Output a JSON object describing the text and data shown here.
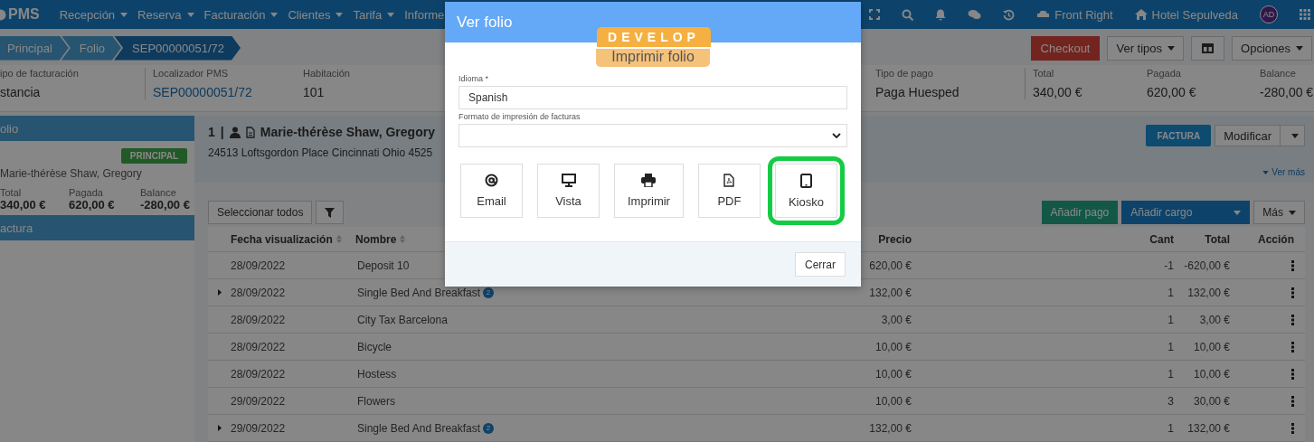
{
  "nav": {
    "logo": "PMS",
    "menu": [
      {
        "label": "Recepción"
      },
      {
        "label": "Reserva"
      },
      {
        "label": "Facturación"
      },
      {
        "label": "Clientes"
      },
      {
        "label": "Tarifa"
      },
      {
        "label": "Informe"
      }
    ],
    "location": "Front Right",
    "hotel": "Hotel Sepulveda",
    "avatar": "AD"
  },
  "breadcrumb": [
    {
      "label": "Principal",
      "selected": false
    },
    {
      "label": "Folio",
      "selected": false
    },
    {
      "label": "SEP00000051/72",
      "selected": true
    }
  ],
  "actions": [
    {
      "kind": "danger",
      "label": "Checkout"
    },
    {
      "kind": "dropdown",
      "label": "Ver tipos"
    },
    {
      "kind": "columns"
    },
    {
      "kind": "dropdown",
      "label": "Opciones"
    }
  ],
  "summary": [
    {
      "label": "ipo de facturación",
      "value": "stancia"
    },
    {
      "label": "Localizador PMS",
      "value": "SEP00000051/72",
      "kind": "link"
    },
    {
      "label": "Habitación",
      "value": "101"
    },
    {
      "label": "Tipo de pago",
      "value": "Paga Huesped"
    },
    {
      "label": "Total",
      "value": "340,00 €"
    },
    {
      "label": "Pagada",
      "value": "620,00 €"
    },
    {
      "label": "Balance",
      "value": "-280,00 €"
    }
  ],
  "left_panel": {
    "folio_header": "olio",
    "badge": "PRINCIPAL",
    "name": "Marie-thérèse Shaw, Gregory",
    "totals": [
      {
        "label": "Total",
        "value": "340,00 €"
      },
      {
        "label": "Pagada",
        "value": "620,00 €"
      },
      {
        "label": "Balance",
        "value": "-280,00 €"
      }
    ],
    "invoice_header": "actura"
  },
  "guest": {
    "number": "1",
    "separator": "|",
    "name": "Marie-thérèse Shaw, Gregory",
    "address": "24513 Loftsgordon Place Cincinnati Ohio 4525",
    "invoice_button": "FACTURA",
    "modify_button": "Modificar",
    "more_link": "Ver más"
  },
  "toolbar": {
    "select_all": "Seleccionar todos",
    "add_payment": "Añadir pago",
    "add_charge": "Añadir cargo",
    "more": "Más"
  },
  "table": {
    "columns": [
      {
        "label": "Fecha visualización",
        "sortable": true
      },
      {
        "label": "Nombre",
        "sortable": true
      },
      {
        "label": "Precio",
        "sortable": false
      },
      {
        "label": "Cant",
        "sortable": false
      },
      {
        "label": "Total",
        "sortable": false
      },
      {
        "label": "Acción",
        "sortable": false
      }
    ],
    "rows": [
      {
        "expandable": false,
        "date": "28/09/2022",
        "name": "Deposit 10",
        "price": "620,00 €",
        "qty": "-1",
        "total": "-620,00 €"
      },
      {
        "expandable": true,
        "date": "28/09/2022",
        "name": "Single Bed And Breakfast",
        "count": "2",
        "price": "132,00 €",
        "qty": "1",
        "total": "132,00 €"
      },
      {
        "expandable": false,
        "date": "28/09/2022",
        "name": "City Tax Barcelona",
        "price": "3,00 €",
        "qty": "1",
        "total": "3,00 €"
      },
      {
        "expandable": false,
        "date": "28/09/2022",
        "name": "Bicycle",
        "price": "10,00 €",
        "qty": "1",
        "total": "10,00 €"
      },
      {
        "expandable": false,
        "date": "28/09/2022",
        "name": "Hostess",
        "price": "10,00 €",
        "qty": "1",
        "total": "10,00 €"
      },
      {
        "expandable": false,
        "date": "29/09/2022",
        "name": "Flowers",
        "price": "10,00 €",
        "qty": "3",
        "total": "30,00 €"
      },
      {
        "expandable": true,
        "date": "29/09/2022",
        "name": "Single Bed And Breakfast",
        "count": "2",
        "price": "132,00 €",
        "qty": "1",
        "total": "132,00 €"
      }
    ]
  },
  "env_badge": "DEVELOP",
  "modal": {
    "title": "Ver folio",
    "subtitle": "Imprimir folio",
    "language": {
      "label": "Idioma *",
      "value": "Spanish"
    },
    "format": {
      "label": "Formato de impresión de facturas"
    },
    "outputs": [
      {
        "kind": "email",
        "label": "Email",
        "highlighted": false
      },
      {
        "kind": "view",
        "label": "Vista",
        "highlighted": false
      },
      {
        "kind": "print",
        "label": "Imprimir",
        "highlighted": false
      },
      {
        "kind": "pdf",
        "label": "PDF",
        "highlighted": false
      },
      {
        "kind": "kiosk",
        "label": "Kiosko",
        "highlighted": true
      }
    ],
    "close": "Cerrar"
  }
}
